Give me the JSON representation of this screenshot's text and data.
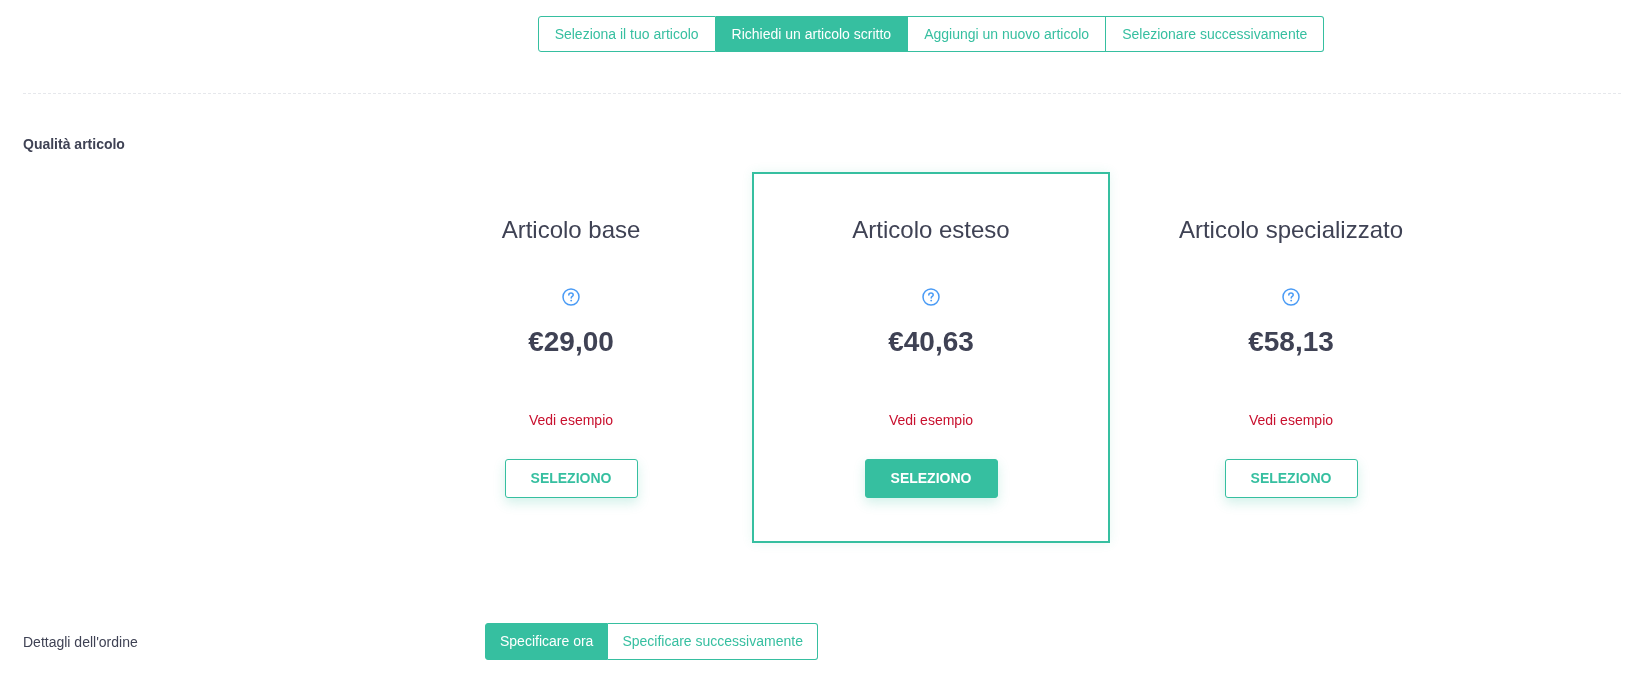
{
  "source_tabs": [
    {
      "label": "Seleziona il tuo articolo",
      "selected": false
    },
    {
      "label": "Richiedi un articolo scritto",
      "selected": true
    },
    {
      "label": "Aggiungi un nuovo articolo",
      "selected": false
    },
    {
      "label": "Selezionare successivamente",
      "selected": false
    }
  ],
  "quality": {
    "label": "Qualità articolo",
    "options": [
      {
        "title": "Articolo base",
        "price": "€29,00",
        "example_link": "Vedi esempio",
        "button": "SELEZIONO",
        "selected": false
      },
      {
        "title": "Articolo esteso",
        "price": "€40,63",
        "example_link": "Vedi esempio",
        "button": "SELEZIONO",
        "selected": true
      },
      {
        "title": "Articolo specializzato",
        "price": "€58,13",
        "example_link": "Vedi esempio",
        "button": "SELEZIONO",
        "selected": false
      }
    ]
  },
  "order_details": {
    "label": "Dettagli dell'ordine",
    "options": [
      {
        "label": "Specificare ora",
        "selected": true
      },
      {
        "label": "Specificare successivamente",
        "selected": false
      }
    ]
  }
}
